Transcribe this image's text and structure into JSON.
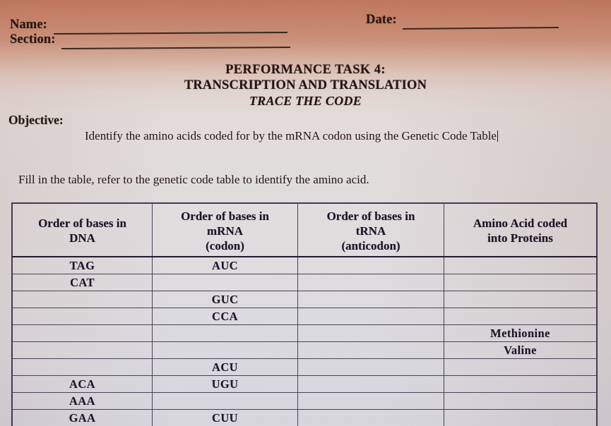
{
  "header": {
    "name_label": "Name:",
    "section_label": "Section:",
    "date_label": "Date:"
  },
  "title": {
    "line1": "PERFORMANCE TASK 4:",
    "line2": "TRANSCRIPTION AND TRANSLATION",
    "line3": "TRACE THE CODE"
  },
  "objective": {
    "label": "Objective:",
    "text": "Identify the amino acids coded for by the mRNA codon using the Genetic Code Table"
  },
  "instruction": "Fill in the table, refer to the genetic code table to identify the amino acid.",
  "table": {
    "headers": [
      {
        "line1": "Order of bases in",
        "line2": "DNA",
        "line3": ""
      },
      {
        "line1": "Order of bases in",
        "line2": "mRNA",
        "line3": "(codon)"
      },
      {
        "line1": "Order of bases in",
        "line2": "tRNA",
        "line3": "(anticodon)"
      },
      {
        "line1": "Amino Acid coded",
        "line2": "into Proteins",
        "line3": ""
      }
    ],
    "rows": [
      {
        "dna": "TAG",
        "mrna": "AUC",
        "trna": "",
        "amino": ""
      },
      {
        "dna": "CAT",
        "mrna": "",
        "trna": "",
        "amino": ""
      },
      {
        "dna": "",
        "mrna": "GUC",
        "trna": "",
        "amino": ""
      },
      {
        "dna": "",
        "mrna": "CCA",
        "trna": "",
        "amino": ""
      },
      {
        "dna": "",
        "mrna": "",
        "trna": "",
        "amino": "Methionine"
      },
      {
        "dna": "",
        "mrna": "",
        "trna": "",
        "amino": "Valine"
      },
      {
        "dna": "",
        "mrna": "ACU",
        "trna": "",
        "amino": ""
      },
      {
        "dna": "ACA",
        "mrna": "UGU",
        "trna": "",
        "amino": ""
      },
      {
        "dna": "AAA",
        "mrna": "",
        "trna": "",
        "amino": ""
      },
      {
        "dna": "GAA",
        "mrna": "CUU",
        "trna": "",
        "amino": ""
      }
    ]
  },
  "colors": {
    "ink": "#241512",
    "table_ink": "#1d1429",
    "rule": "#2e1d18",
    "grid": "#4a4158",
    "paper_top": "#c1765c",
    "paper_bottom": "#d6d6de"
  }
}
